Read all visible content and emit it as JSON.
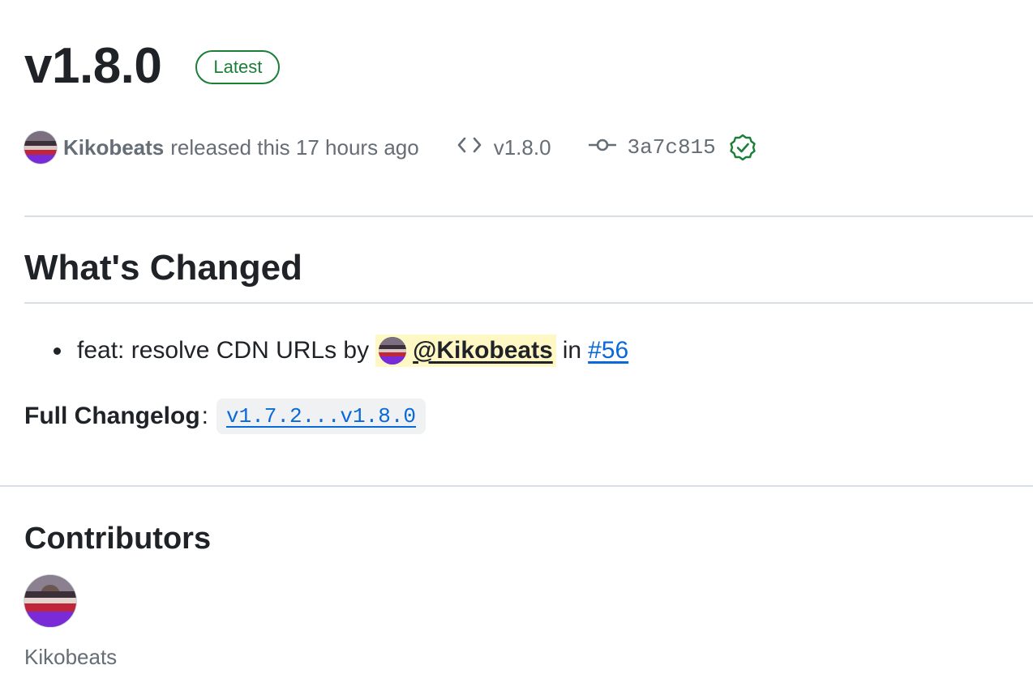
{
  "release": {
    "title": "v1.8.0",
    "badge": "Latest"
  },
  "meta": {
    "author": "Kikobeats",
    "released_text": "released this 17 hours ago",
    "tag": "v1.8.0",
    "commit": "3a7c815",
    "verified_icon": "verified-check-icon",
    "tag_icon": "code-icon",
    "commit_icon": "git-commit-icon"
  },
  "whats_changed": {
    "heading": "What's Changed",
    "items": [
      {
        "text": "feat: resolve CDN URLs by",
        "mention": "@Kikobeats",
        "in_text": "in",
        "pr": "#56"
      }
    ]
  },
  "changelog": {
    "label": "Full Changelog",
    "colon": ":",
    "link": "v1.7.2...v1.8.0"
  },
  "contributors": {
    "heading": "Contributors",
    "names": [
      "Kikobeats"
    ]
  },
  "colors": {
    "latest_green": "#1a7f37",
    "link_blue": "#0969da",
    "muted": "#656d76",
    "mention_bg": "#fff8c5"
  }
}
